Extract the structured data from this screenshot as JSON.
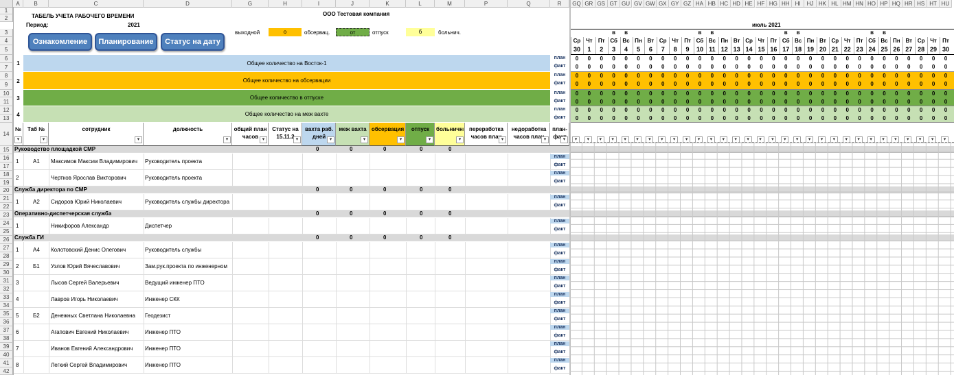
{
  "columns": [
    "A",
    "B",
    "C",
    "D",
    "G",
    "H",
    "I",
    "J",
    "K",
    "L",
    "M",
    "P",
    "Q",
    "R",
    "GQ",
    "GR",
    "GS",
    "GT",
    "GU",
    "GV",
    "GW",
    "GX",
    "GY",
    "GZ",
    "HA",
    "HB",
    "HC",
    "HD",
    "HE",
    "HF",
    "HG",
    "HH",
    "HI",
    "HJ",
    "HK",
    "HL",
    "HM",
    "HN",
    "HO",
    "HP",
    "HQ",
    "HR",
    "HS",
    "HT",
    "HU"
  ],
  "rows": [
    "1",
    "2",
    "3",
    "4",
    "5",
    "6",
    "7",
    "8",
    "9",
    "10",
    "11",
    "12",
    "13",
    "14",
    "15",
    "16",
    "17",
    "18",
    "19",
    "20",
    "21",
    "22",
    "23",
    "24",
    "25",
    "26",
    "27",
    "28",
    "29",
    "30",
    "31",
    "32",
    "33",
    "34",
    "35",
    "36",
    "37",
    "38",
    "39",
    "40",
    "41",
    "42"
  ],
  "header": {
    "title": "ТАБЕЛЬ УЧЕТА РАБОЧЕГО ВРЕМЕНИ",
    "period_label": "Период:",
    "year": "2021",
    "company": "ООО Тестовая компания",
    "month": "июль 2021"
  },
  "buttons": {
    "review": "Ознакомление",
    "planning": "Планирование",
    "status_date": "Статус на дату"
  },
  "legend": [
    {
      "label": "выходной",
      "code": "о",
      "color": "#ffc000"
    },
    {
      "label": "обсервац.",
      "code": "от",
      "color": "#70ad47"
    },
    {
      "label": "отпуск",
      "code": "б",
      "color": "#ffff99"
    },
    {
      "label": "больнич.",
      "code": "",
      "color": ""
    }
  ],
  "calendar": {
    "weekdays": [
      "Ср",
      "Чт",
      "Пт",
      "Сб",
      "Вс",
      "Пн",
      "Вт",
      "Ср",
      "Чт",
      "Пт",
      "Сб",
      "Вс",
      "Пн",
      "Вт",
      "Ср",
      "Чт",
      "Пт",
      "Сб",
      "Вс",
      "Пн",
      "Вт",
      "Ср",
      "Чт",
      "Пт",
      "Сб",
      "Вс",
      "Пн",
      "Вт",
      "Ср",
      "Чт",
      "Пт"
    ],
    "days": [
      "30",
      "1",
      "2",
      "3",
      "4",
      "5",
      "6",
      "7",
      "8",
      "9",
      "10",
      "11",
      "12",
      "13",
      "14",
      "15",
      "16",
      "17",
      "18",
      "19",
      "20",
      "21",
      "22",
      "23",
      "24",
      "25",
      "26",
      "27",
      "28",
      "29",
      "30"
    ],
    "weekend_marks": [
      "",
      "",
      "",
      "в",
      "в",
      "",
      "",
      "",
      "",
      "",
      "в",
      "в",
      "",
      "",
      "",
      "",
      "",
      "в",
      "в",
      "",
      "",
      "",
      "",
      "",
      "в",
      "в",
      "",
      "",
      "",
      "",
      ""
    ]
  },
  "summary": [
    {
      "num": "1",
      "label": "Общее количество на Восток-1",
      "color": "#bdd7ee"
    },
    {
      "num": "2",
      "label": "Общее количество на обсервации",
      "color": "#ffc000"
    },
    {
      "num": "3",
      "label": "Общее количество в отпуске",
      "color": "#70ad47"
    },
    {
      "num": "4",
      "label": "Общее количество на меж вахте",
      "color": "#c6e0b4"
    }
  ],
  "plan_label": "план",
  "fact_label": "факт",
  "zero": "0",
  "table_headers": {
    "num": "№",
    "tab": "Таб №",
    "employee": "сотрудник",
    "position": "должность",
    "total_plan": "общий план часов",
    "status": "Статус на 15.11.2",
    "shift_days": "вахта раб. дней",
    "inter_shift": "меж вахта",
    "observation": "обсервация",
    "vacation": "отпуск",
    "sick": "больничные",
    "overtime": "переработка часов план",
    "undertime": "недоработка часов план",
    "planfact": "план-факт"
  },
  "groups": [
    {
      "name": "Руководство площадкой СМР",
      "employees": [
        {
          "num": "1",
          "tab": "А1",
          "name": "Максимов Максим Владимирович",
          "position": "Руководитель проекта"
        },
        {
          "num": "2",
          "tab": "",
          "name": "Чертков Ярослав Викторович",
          "position": "Руководитель проекта"
        }
      ]
    },
    {
      "name": "Служба директора по СМР",
      "employees": [
        {
          "num": "1",
          "tab": "А2",
          "name": "Сидоров Юрий Николаевич",
          "position": "Руководитель службы директора"
        }
      ]
    },
    {
      "name": "Оперативно-диспетчерская служба",
      "employees": [
        {
          "num": "1",
          "tab": "",
          "name": "Никифоров Александр",
          "position": "Диспетчер"
        }
      ]
    },
    {
      "name": "Служба ГИ",
      "employees": [
        {
          "num": "1",
          "tab": "А4",
          "name": "Колотовский Денис Олегович",
          "position": "Руководитель службы"
        },
        {
          "num": "2",
          "tab": "Б1",
          "name": "Узлов Юрий Вячеславович",
          "position": "Зам.рук.проекта по инженерном"
        },
        {
          "num": "3",
          "tab": "",
          "name": "Лысов Сергей Валерьевич",
          "position": "Ведущий инженер ПТО"
        },
        {
          "num": "4",
          "tab": "",
          "name": "Лавров Игорь Николаевич",
          "position": "Инженер СКК"
        },
        {
          "num": "5",
          "tab": "Б2",
          "name": "Денежных Светлана Николаевна",
          "position": "Геодезист"
        },
        {
          "num": "6",
          "tab": "",
          "name": "Агапович Евгений Николаевич",
          "position": "Инженер ПТО"
        },
        {
          "num": "7",
          "tab": "",
          "name": "Иванов Евгений Александрович",
          "position": "Инженер ПТО"
        },
        {
          "num": "8",
          "tab": "",
          "name": "Легкий Сергей Владимирович",
          "position": "Инженер ПТО"
        }
      ]
    }
  ]
}
